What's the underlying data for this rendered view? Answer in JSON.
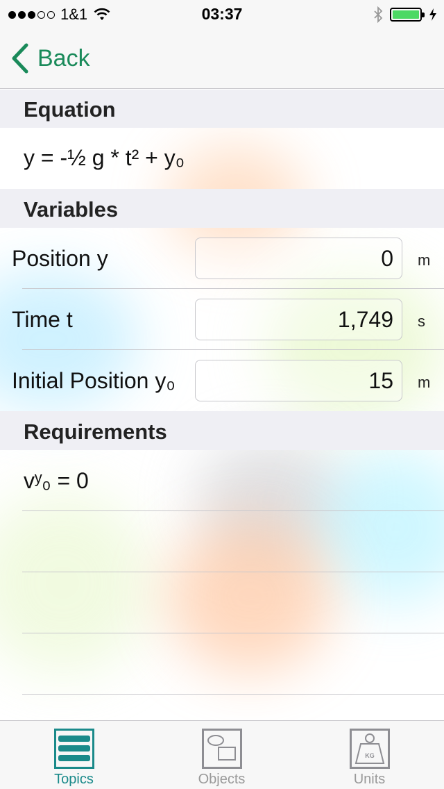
{
  "status_bar": {
    "carrier": "1&1",
    "time": "03:37",
    "battery_level": 1.0
  },
  "nav": {
    "back_label": "Back"
  },
  "equation": {
    "header": "Equation",
    "formula": "y = -½ g * t² + y₀"
  },
  "variables": {
    "header": "Variables",
    "rows": [
      {
        "label": "Position y",
        "value": "0",
        "unit": "m"
      },
      {
        "label": "Time t",
        "value": "1,749",
        "unit": "s"
      },
      {
        "label": "Initial Position y₀",
        "value": "15",
        "unit": "m"
      }
    ]
  },
  "requirements": {
    "header": "Requirements",
    "items": [
      "vʸ₀ = 0"
    ]
  },
  "tab_bar": {
    "tabs": [
      {
        "label": "Topics",
        "icon": "topics-icon",
        "active": true
      },
      {
        "label": "Objects",
        "icon": "objects-icon",
        "active": false
      },
      {
        "label": "Units",
        "icon": "units-weight-icon",
        "active": false
      }
    ]
  },
  "colors": {
    "accent": "#1a8a5a",
    "tab_active": "#1a8a8a",
    "battery": "#4cd964"
  }
}
